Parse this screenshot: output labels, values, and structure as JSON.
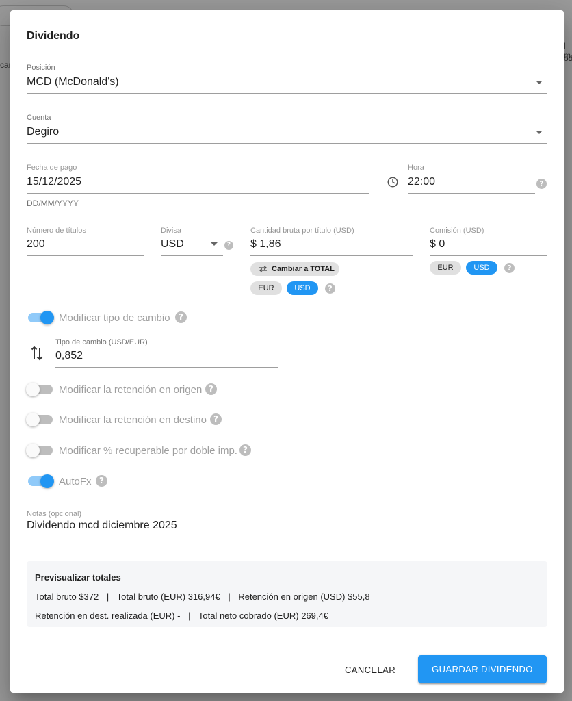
{
  "background": {
    "fragments": [
      "can",
      "l m",
      "odo"
    ]
  },
  "dialog": {
    "title": "Dividendo"
  },
  "position": {
    "label": "Posición",
    "value": "MCD (McDonald's)"
  },
  "account": {
    "label": "Cuenta",
    "value": "Degiro"
  },
  "payment_date": {
    "label": "Fecha de pago",
    "value": "15/12/2025",
    "hint": "DD/MM/YYYY"
  },
  "time": {
    "label": "Hora",
    "value": "22:00"
  },
  "shares": {
    "label": "Número de títulos",
    "value": "200"
  },
  "currency": {
    "label": "Divisa",
    "value": "USD"
  },
  "gross_per_share": {
    "label": "Cantidad bruta por título (USD)",
    "value": "$ 1,86",
    "toggle_total_label": "Cambiar a TOTAL",
    "currency_options": [
      "EUR",
      "USD"
    ],
    "selected_currency": "USD"
  },
  "commission": {
    "label": "Comisión (USD)",
    "value": "$ 0",
    "currency_options": [
      "EUR",
      "USD"
    ],
    "selected_currency": "USD"
  },
  "switches": {
    "exchange_rate": {
      "label": "Modificar tipo de cambio",
      "on": true
    },
    "withholding_origin": {
      "label": "Modificar la retención en origen",
      "on": false
    },
    "withholding_destination": {
      "label": "Modificar la retención en destino",
      "on": false
    },
    "recoverable_double": {
      "label": "Modificar % recuperable por doble imp.",
      "on": false
    },
    "autofx": {
      "label": "AutoFx",
      "on": true
    }
  },
  "exchange_rate_field": {
    "label": "Tipo de cambio (USD/EUR)",
    "value": "0,852"
  },
  "notes": {
    "label": "Notas (opcional)",
    "value": "Dividendo mcd diciembre 2025"
  },
  "preview": {
    "title": "Previsualizar totales",
    "separator": "|",
    "gross_label": "Total bruto",
    "gross_value": "$372",
    "gross_eur_label": "Total bruto (EUR)",
    "gross_eur_value": "316,94€",
    "withholding_origin_label": "Retención en origen (USD)",
    "withholding_origin_value": "$55,8",
    "withholding_dest_label": "Retención en dest. realizada (EUR)",
    "withholding_dest_value": "-",
    "net_label": "Total neto cobrado (EUR)",
    "net_value": "269,4€"
  },
  "actions": {
    "cancel": "CANCELAR",
    "save": "GUARDAR DIVIDENDO"
  },
  "colors": {
    "accent": "#2196f3",
    "accent_light": "#90caf9",
    "chip": "#e0e0e0",
    "preview_bg": "#f5f6f8"
  },
  "icons": [
    "caret-down-icon",
    "clock-icon",
    "help-icon",
    "swap-horizontal-icon",
    "swap-vertical-icon"
  ]
}
